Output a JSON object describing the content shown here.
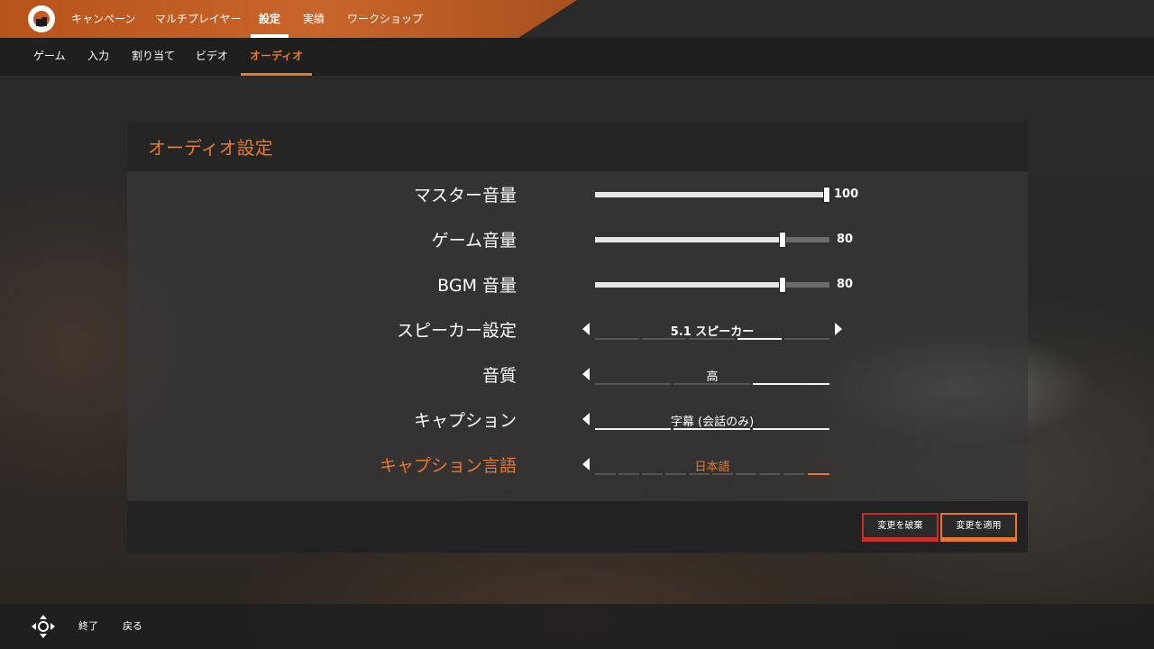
{
  "top_nav": {
    "items": [
      {
        "label": "キャンペーン",
        "active": false
      },
      {
        "label": "マルチプレイヤー",
        "active": false
      },
      {
        "label": "設定",
        "active": true
      },
      {
        "label": "実績",
        "active": false
      },
      {
        "label": "ワークショップ",
        "active": false
      }
    ]
  },
  "sub_nav": {
    "items": [
      {
        "label": "ゲーム",
        "active": false
      },
      {
        "label": "入力",
        "active": false
      },
      {
        "label": "割り当て",
        "active": false
      },
      {
        "label": "ビデオ",
        "active": false
      },
      {
        "label": "オーディオ",
        "active": true
      }
    ]
  },
  "panel": {
    "title": "オーディオ設定",
    "settings": [
      {
        "label": "マスター音量",
        "type": "slider",
        "value": "100",
        "level": 100
      },
      {
        "label": "ゲーム音量",
        "type": "slider",
        "value": "80",
        "level": 80
      },
      {
        "label": "BGM 音量",
        "type": "slider",
        "value": "80",
        "level": 80
      },
      {
        "label": "スピーカー設定",
        "type": "selector",
        "value": "5.1 スピーカー"
      },
      {
        "label": "音質",
        "type": "selector",
        "value": "高"
      },
      {
        "label": "キャプション",
        "type": "selector",
        "value": "字幕 (会話のみ)"
      },
      {
        "label": "キャプション言語",
        "type": "selector",
        "value": "日本語",
        "highlighted": true
      }
    ]
  },
  "buttons": {
    "discard": "変更を破棄",
    "apply": "変更を適用"
  },
  "footer": {
    "exit": "終了",
    "back": "戻る"
  },
  "colors": {
    "accent": "#e8782c",
    "danger": "#c7302a",
    "topbar": "#c15c24"
  }
}
